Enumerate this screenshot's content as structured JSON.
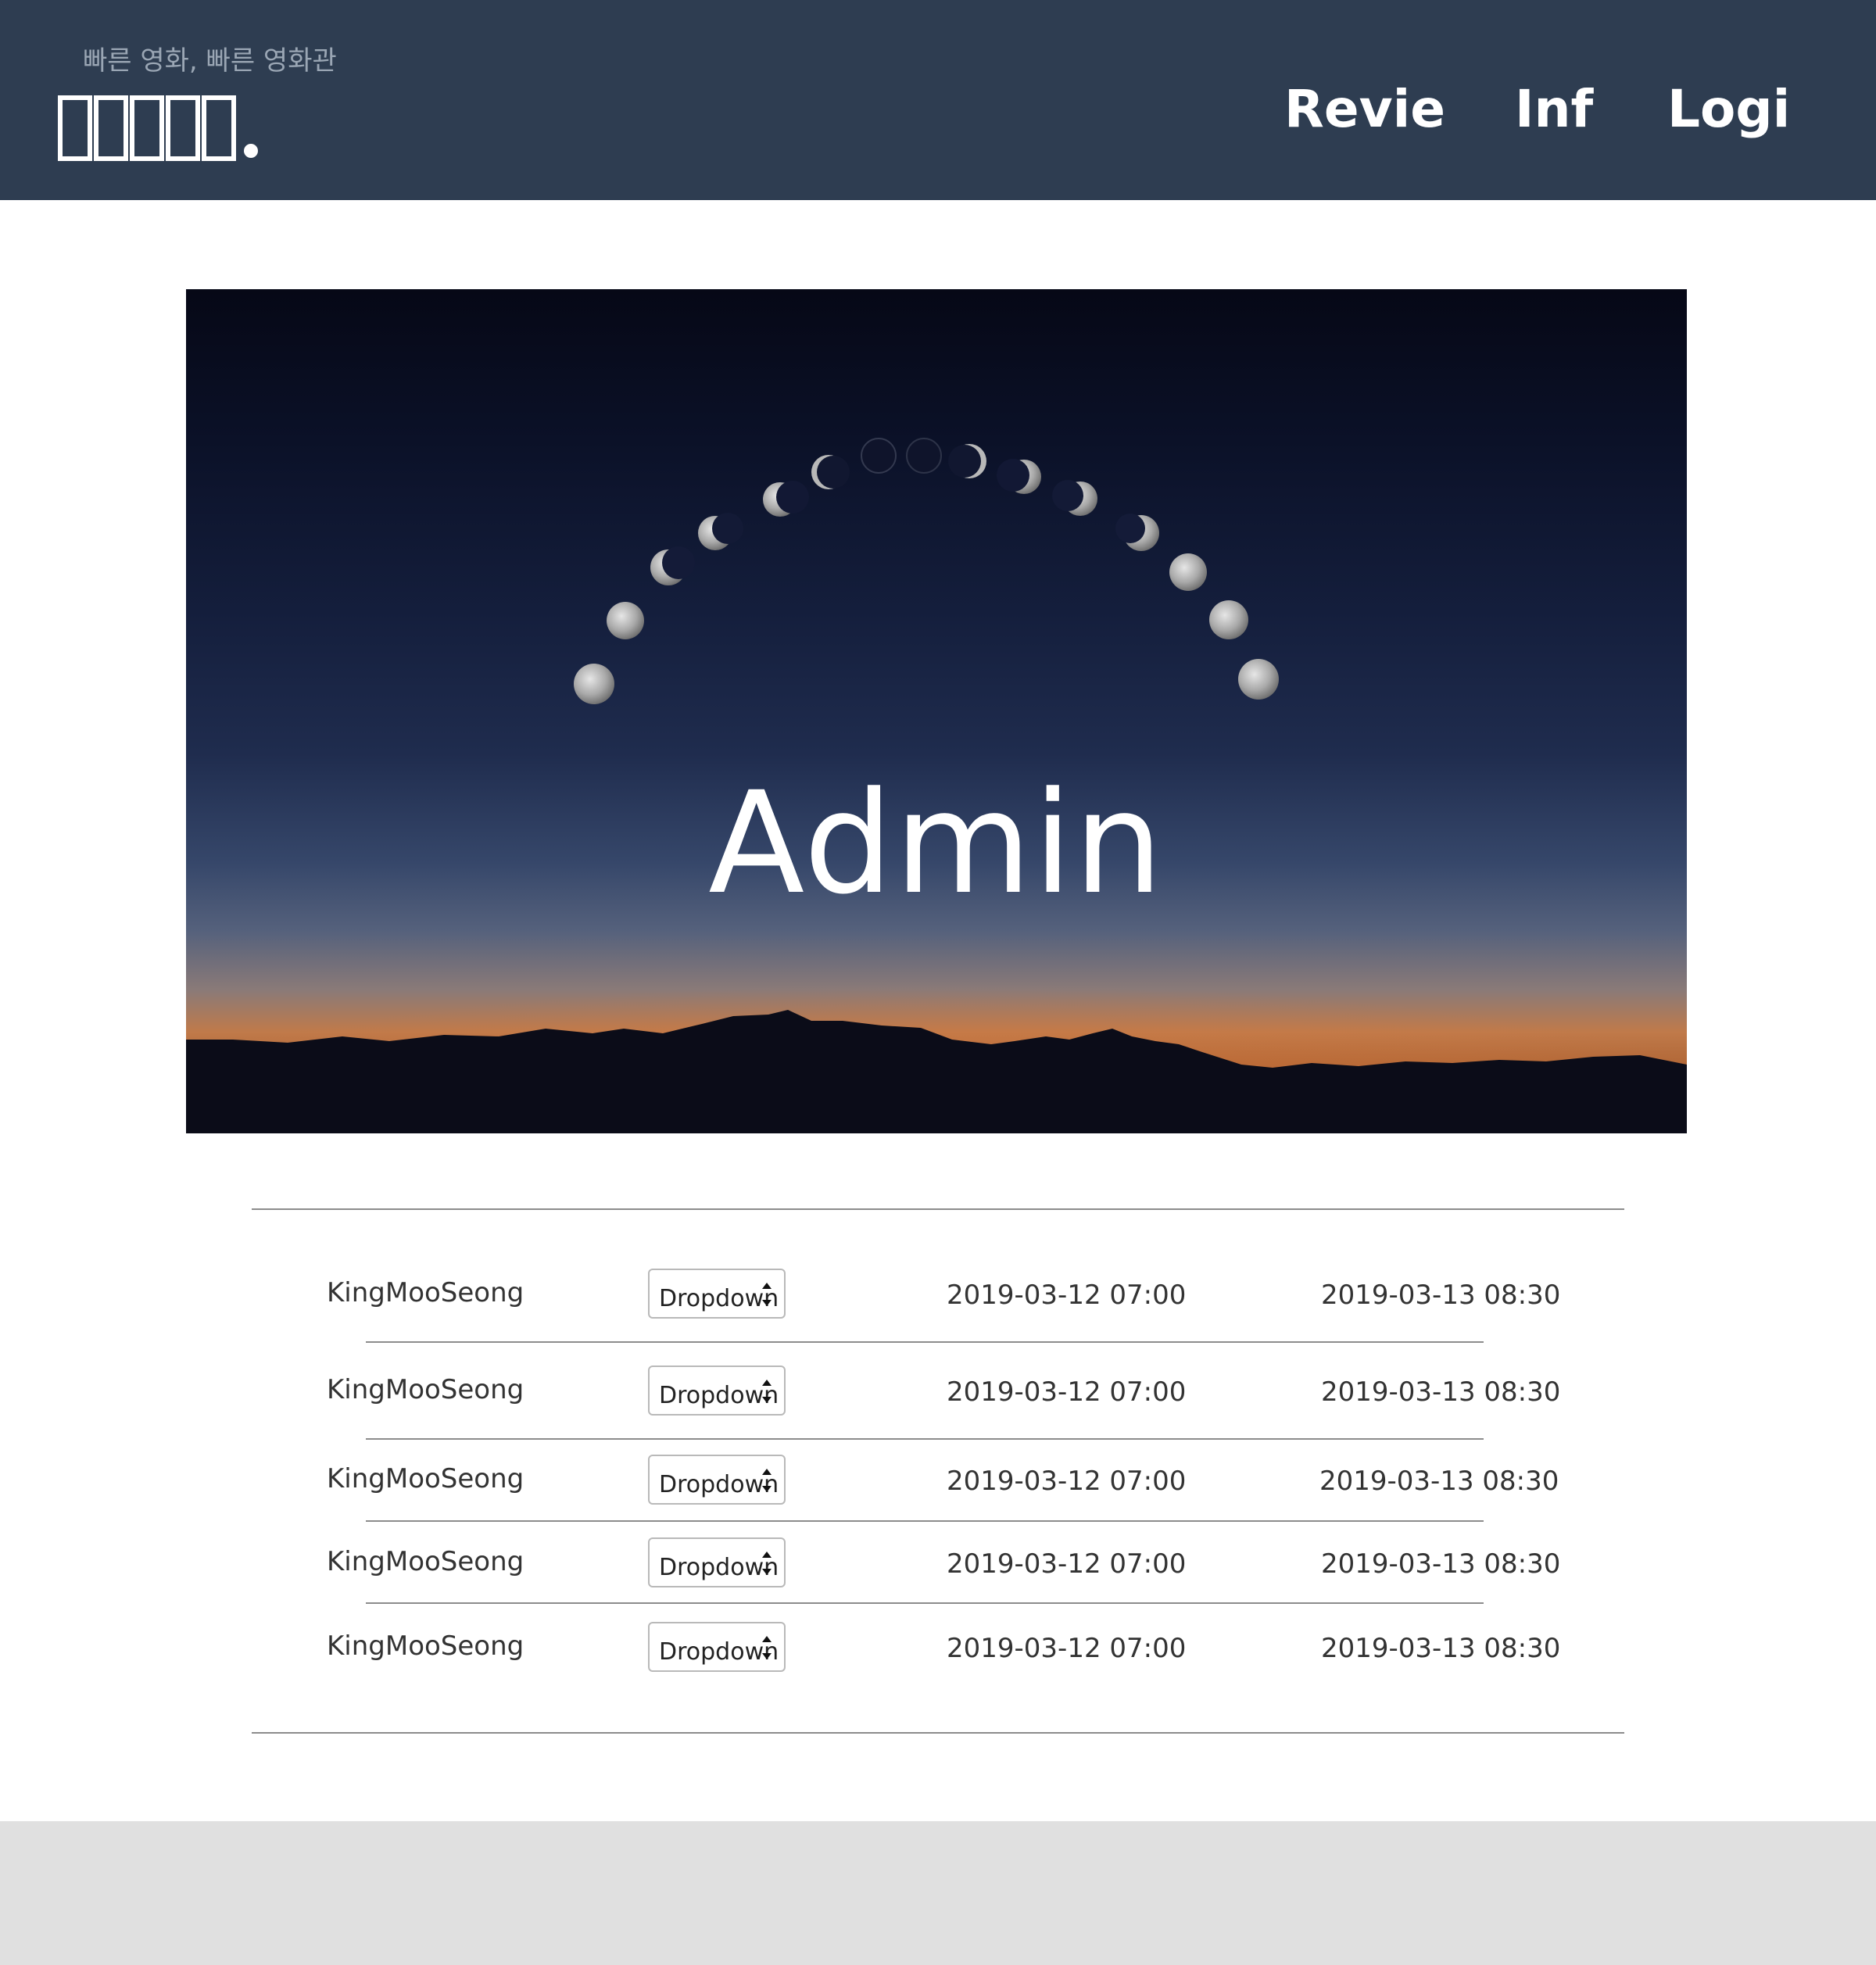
{
  "header": {
    "tagline": "빠른 영화, 빠른 영화관",
    "nav": [
      {
        "label": "Revie"
      },
      {
        "label": "Inf"
      },
      {
        "label": "Logi"
      }
    ]
  },
  "hero": {
    "title": "Admin"
  },
  "rows": [
    {
      "user": "KingMooSeong",
      "dropdown": "Dropdown",
      "start": "2019-03-12 07:00",
      "end": "2019-03-13 08:30"
    },
    {
      "user": "KingMooSeong",
      "dropdown": "Dropdown",
      "start": "2019-03-12 07:00",
      "end": "2019-03-13 08:30"
    },
    {
      "user": "KingMooSeong",
      "dropdown": "Dropdown",
      "start": "2019-03-12 07:00",
      "end": "2019-03-13 08:30"
    },
    {
      "user": "KingMooSeong",
      "dropdown": "Dropdown",
      "start": "2019-03-12 07:00",
      "end": "2019-03-13 08:30"
    },
    {
      "user": "KingMooSeong",
      "dropdown": "Dropdown",
      "start": "2019-03-12 07:00",
      "end": "2019-03-13 08:30"
    }
  ],
  "colors": {
    "header_bg": "#2e3d51",
    "footer_bg": "#e0e0e0",
    "divider": "#8c8c8c"
  }
}
